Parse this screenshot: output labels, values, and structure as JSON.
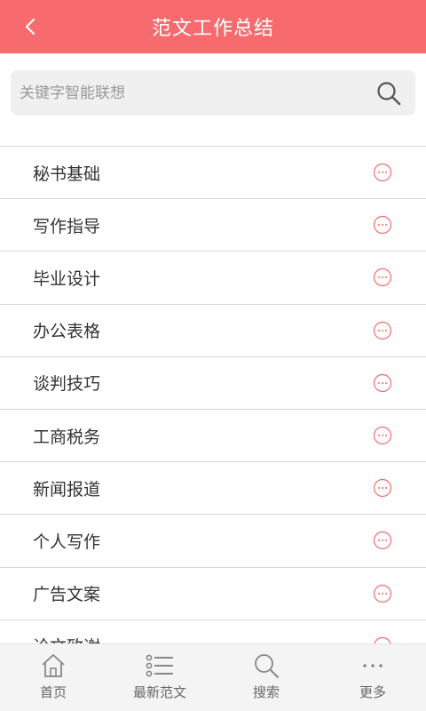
{
  "header": {
    "title": "范文工作总结"
  },
  "search": {
    "placeholder": "关键字智能联想"
  },
  "list": {
    "items": [
      {
        "label": "秘书基础"
      },
      {
        "label": "写作指导"
      },
      {
        "label": "毕业设计"
      },
      {
        "label": "办公表格"
      },
      {
        "label": "谈判技巧"
      },
      {
        "label": "工商税务"
      },
      {
        "label": "新闻报道"
      },
      {
        "label": "个人写作"
      },
      {
        "label": "广告文案"
      },
      {
        "label": "论文致谢"
      }
    ]
  },
  "tabbar": {
    "tabs": [
      {
        "label": "首页",
        "icon": "home-icon"
      },
      {
        "label": "最新范文",
        "icon": "list-icon"
      },
      {
        "label": "搜索",
        "icon": "search-icon"
      },
      {
        "label": "更多",
        "icon": "more-dots-icon"
      }
    ]
  },
  "colors": {
    "accent": "#f76b6e",
    "divider": "#d8d8d8",
    "tab_icon": "#888888"
  }
}
